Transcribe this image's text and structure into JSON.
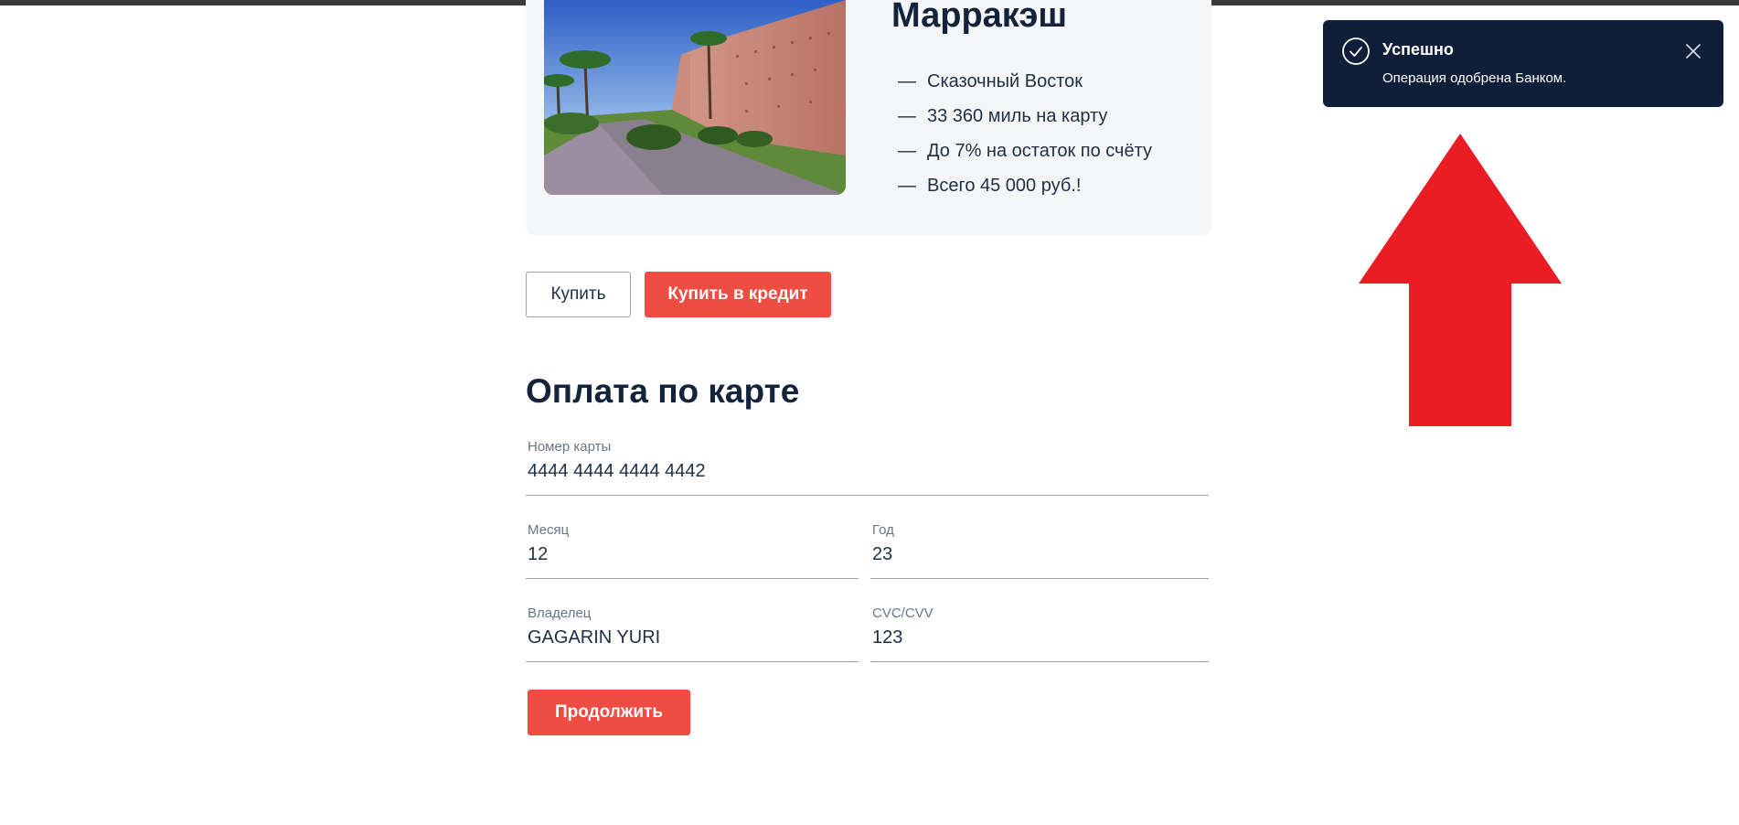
{
  "offer": {
    "title": "Марракэш",
    "image_icon": "marrakesh-wall-photo",
    "features": [
      {
        "dash": "—",
        "text": "Сказочный Восток"
      },
      {
        "dash": "—",
        "text": "33 360 миль на карту"
      },
      {
        "dash": "—",
        "text": "До 7% на остаток по счёту"
      },
      {
        "dash": "—",
        "text": "Всего 45 000 руб.!"
      }
    ]
  },
  "buttons": {
    "buy_label": "Купить",
    "buy_credit_label": "Купить в кредит",
    "continue_label": "Продолжить"
  },
  "payment": {
    "section_title": "Оплата по карте",
    "card_number": {
      "label": "Номер карты",
      "value": "4444 4444 4444 4442"
    },
    "month": {
      "label": "Месяц",
      "value": "12"
    },
    "year": {
      "label": "Год",
      "value": "23"
    },
    "owner": {
      "label": "Владелец",
      "value": "GAGARIN YURI"
    },
    "cvc": {
      "label": "CVC/CVV",
      "value": "123"
    }
  },
  "toast": {
    "title": "Успешно",
    "message": "Операция одобрена Банком.",
    "status_icon": "check-circle-icon",
    "close_icon": "close-icon"
  },
  "annotation": {
    "arrow_icon": "up-arrow-icon"
  },
  "colors": {
    "accent": "#ef4c42",
    "toast_bg": "#0f1f3a",
    "heading": "#12233b",
    "card_bg": "#f4f6f8",
    "arrow": "#ec1c24"
  }
}
